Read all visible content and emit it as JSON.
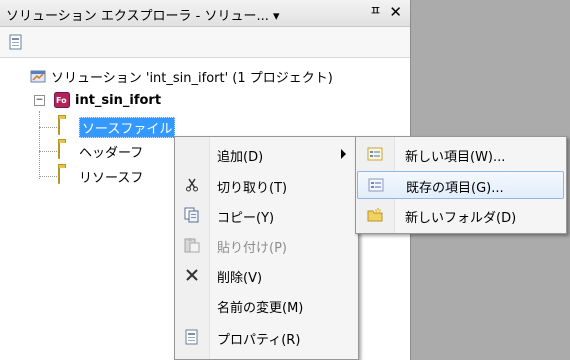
{
  "window": {
    "title": "ソリューション エクスプローラ - ソリュー... ▾ ",
    "pin_glyph": "ㅍ",
    "close_glyph": "✕"
  },
  "tree": {
    "solution_label": "ソリューション 'int_sin_ifort' (1 プロジェクト)",
    "project_label": "int_sin_ifort",
    "project_badge": "Fo",
    "folders": [
      {
        "label": "ソースファイル"
      },
      {
        "label": "ヘッダーフ"
      },
      {
        "label": "リソースフ"
      }
    ]
  },
  "context_menu": {
    "items": [
      {
        "label": "追加(D)",
        "icon": "none",
        "submenu": true
      },
      {
        "label": "切り取り(T)",
        "icon": "scissors-icon"
      },
      {
        "label": "コピー(Y)",
        "icon": "copy-icon"
      },
      {
        "label": "貼り付け(P)",
        "icon": "paste-icon",
        "disabled": true
      },
      {
        "label": "削除(V)",
        "icon": "delete-icon"
      },
      {
        "label": "名前の変更(M)",
        "icon": "none"
      },
      {
        "label": "プロパティ(R)",
        "icon": "properties-icon"
      }
    ]
  },
  "submenu": {
    "items": [
      {
        "label": "新しい項目(W)...",
        "icon": "new-item-icon"
      },
      {
        "label": "既存の項目(G)...",
        "icon": "existing-item-icon",
        "highlighted": true
      },
      {
        "label": "新しいフォルダ(D)",
        "icon": "new-folder-icon"
      }
    ]
  },
  "colors": {
    "selection": "#3399ff",
    "background_gray": "#ababab",
    "menu_highlight_border": "#8fb8e6"
  }
}
